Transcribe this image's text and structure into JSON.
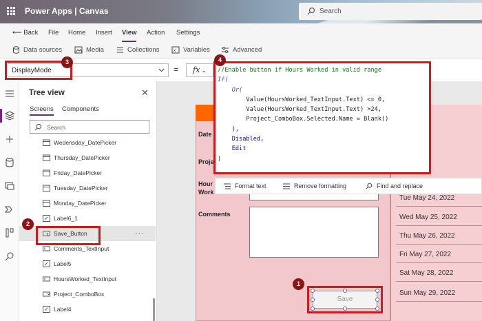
{
  "titlebar": {
    "app_title": "Power Apps  |  Canvas",
    "search_placeholder": "Search"
  },
  "menu": {
    "back": "Back",
    "items": [
      "File",
      "Home",
      "Insert",
      "View",
      "Action",
      "Settings"
    ],
    "active": "View"
  },
  "toolbar": {
    "items": [
      "Data sources",
      "Media",
      "Collections",
      "Variables",
      "Advanced"
    ]
  },
  "formula_bar": {
    "property": "DisplayMode",
    "equals": "=",
    "fx": "fx",
    "code_lines": [
      "//Enable button if Hours Worked in valid range",
      "If(",
      "    Or(",
      "        Value(HoursWorked_TextInput.Text) <= 0,",
      "        Value(HoursWorked_TextInput.Text) >24,",
      "        Project_ComboBox.Selected.Name = Blank()",
      "    ),",
      "    Disabled,",
      "    Edit",
      ")"
    ],
    "actions": [
      "Format text",
      "Remove formatting",
      "Find and replace"
    ]
  },
  "tree_view": {
    "title": "Tree view",
    "tabs": [
      "Screens",
      "Components"
    ],
    "search_placeholder": "Search",
    "items": [
      "Wedensday_DatePicker",
      "Thursday_DatePicker",
      "Friday_DatePicker",
      "Tuesday_DatePicker",
      "Monday_DatePicker",
      "Label6_1",
      "Save_Button",
      "Comments_TextInput",
      "Label5",
      "HoursWorked_TextInput",
      "Project_ComboBox",
      "Label4"
    ],
    "selected": "Save_Button"
  },
  "canvas": {
    "labels": {
      "date": "Date",
      "project": "Proje",
      "hours": "Hour Work",
      "comments": "Comments"
    },
    "dates": [
      "Tue May 24, 2022",
      "Wed May 25, 2022",
      "Thu May 26, 2022",
      "Fri May 27, 2022",
      "Sat May 28, 2022",
      "Sun May 29, 2022"
    ],
    "save_label": "Save"
  },
  "callouts": [
    "1",
    "2",
    "3",
    "4"
  ],
  "colors": {
    "accent": "#742774",
    "annotation": "#c41e1e",
    "form_bg": "#f2c8cc",
    "header_orange": "#ff6600"
  }
}
